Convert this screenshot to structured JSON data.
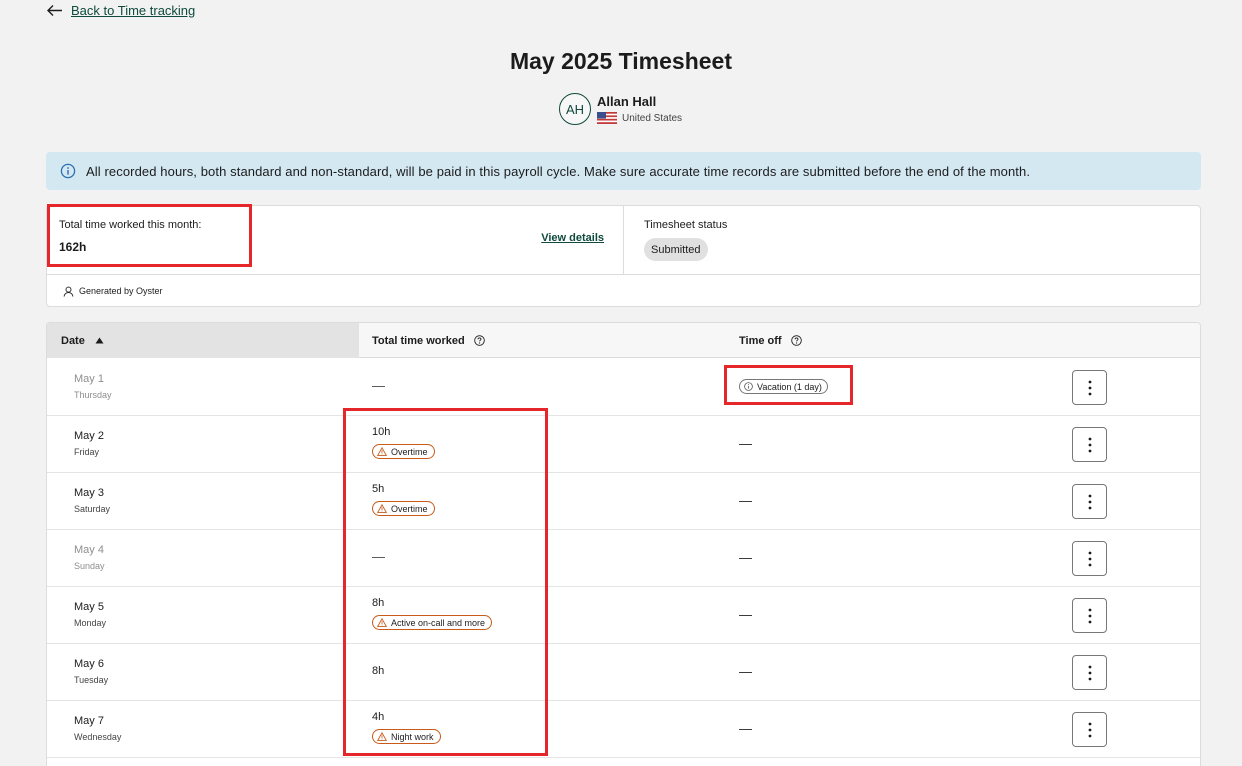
{
  "back_link": {
    "label": "Back to Time tracking"
  },
  "title": "May 2025 Timesheet",
  "user": {
    "initials": "AH",
    "name": "Allan Hall",
    "country": "United States"
  },
  "banner": {
    "text": "All recorded hours, both standard and non-standard, will be paid in this payroll cycle. Make sure accurate time records are submitted before the end of the month."
  },
  "summary": {
    "total_label": "Total time worked this month:",
    "total_value": "162h",
    "view_details": "View details",
    "status_label": "Timesheet status",
    "status_value": "Submitted",
    "generated_by": "Generated by Oyster"
  },
  "table": {
    "columns": {
      "date": "Date",
      "worked": "Total time worked",
      "time_off": "Time off"
    },
    "rows": [
      {
        "date": "May 1",
        "weekday": "Thursday",
        "worked": "—",
        "badge": "",
        "time_off": "Vacation (1 day)"
      },
      {
        "date": "May 2",
        "weekday": "Friday",
        "worked": "10h",
        "badge": "Overtime",
        "time_off": "—"
      },
      {
        "date": "May 3",
        "weekday": "Saturday",
        "worked": "5h",
        "badge": "Overtime",
        "time_off": "—"
      },
      {
        "date": "May 4",
        "weekday": "Sunday",
        "worked": "—",
        "badge": "",
        "time_off": "—"
      },
      {
        "date": "May 5",
        "weekday": "Monday",
        "worked": "8h",
        "badge": "Active on-call and more",
        "time_off": "—"
      },
      {
        "date": "May 6",
        "weekday": "Tuesday",
        "worked": "8h",
        "badge": "",
        "time_off": "—"
      },
      {
        "date": "May 7",
        "weekday": "Wednesday",
        "worked": "4h",
        "badge": "Night work",
        "time_off": "—"
      }
    ]
  },
  "colors": {
    "accent": "#0f4a3c",
    "banner_bg": "#d4e8f2",
    "highlight": "#e5262a",
    "warning": "#c85a1a"
  }
}
